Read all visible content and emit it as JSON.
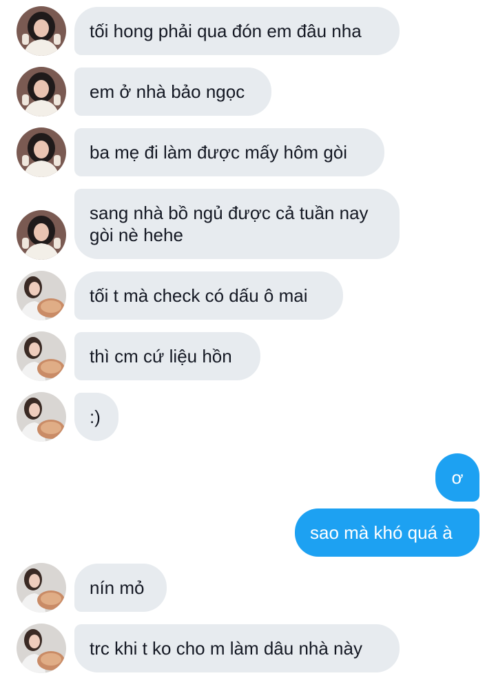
{
  "conversation": {
    "messages": [
      {
        "sender": "contact_a",
        "text": "tối hong phải qua đón em đâu nha"
      },
      {
        "sender": "contact_a",
        "text": "em ở nhà bảo ngọc"
      },
      {
        "sender": "contact_a",
        "text": "ba mẹ đi làm được mấy hôm gòi"
      },
      {
        "sender": "contact_a",
        "text": "sang nhà bồ ngủ được cả tuần nay gòi nè hehe"
      },
      {
        "sender": "contact_b",
        "text": "tối t mà check có dấu ô mai"
      },
      {
        "sender": "contact_b",
        "text": "thì cm cứ liệu hồn"
      },
      {
        "sender": "contact_b",
        "text": ":)"
      },
      {
        "sender": "me",
        "text": "ơ"
      },
      {
        "sender": "me",
        "text": "sao mà khó quá à"
      },
      {
        "sender": "contact_b",
        "text": "nín mỏ"
      },
      {
        "sender": "contact_b",
        "text": "trc khi t ko cho m làm dâu nhà này"
      }
    ]
  },
  "colors": {
    "incoming_bubble": "#e7ebef",
    "outgoing_bubble": "#1da1f2",
    "incoming_text": "#141823",
    "outgoing_text": "#ffffff"
  },
  "icons": {
    "contact_a_avatar": "avatar-girl-dark-hair-icon",
    "contact_b_avatar": "avatar-girl-with-food-icon"
  }
}
